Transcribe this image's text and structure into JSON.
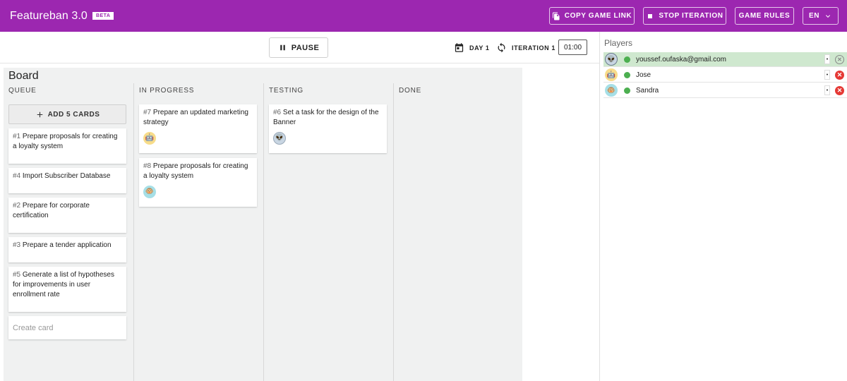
{
  "header": {
    "title": "Featureban 3.0",
    "badge": "BETA",
    "copy_link": "COPY GAME LINK",
    "stop_iteration": "STOP ITERATION",
    "game_rules": "GAME RULES",
    "language": "EN"
  },
  "toolbar": {
    "pause": "PAUSE",
    "day": "DAY 1",
    "iteration": "ITERATION 1",
    "timer": "01:00"
  },
  "board": {
    "title": "Board",
    "columns": {
      "queue": "QUEUE",
      "in_progress": "IN PROGRESS",
      "testing": "TESTING",
      "done": "DONE"
    },
    "add_cards": "ADD 5 CARDS",
    "queue_cards": [
      {
        "num": "#1",
        "text": "Prepare proposals for creating a loyalty system"
      },
      {
        "num": "#4",
        "text": "Import Subscriber Database"
      },
      {
        "num": "#2",
        "text": "Prepare for corporate certification"
      },
      {
        "num": "#3",
        "text": "Prepare a tender application"
      },
      {
        "num": "#5",
        "text": "Generate a list of hypotheses for improvements in user enrollment rate"
      }
    ],
    "create_card": "Create card",
    "progress_cards": [
      {
        "num": "#7",
        "text": "Prepare an updated marketing strategy",
        "avatar": "robot-avatar"
      },
      {
        "num": "#8",
        "text": "Prepare proposals for creating a loyalty system",
        "avatar": "monkey-avatar"
      }
    ],
    "testing_cards": [
      {
        "num": "#6",
        "text": "Set a task for the design of the Banner",
        "avatar": "alien-avatar"
      }
    ]
  },
  "players": {
    "title": "Players",
    "list": [
      {
        "name": "youssef.oufaska@gmail.com",
        "avatar": "alien-avatar",
        "status_color": "#4caf50",
        "mark": "•"
      },
      {
        "name": "Jose",
        "avatar": "robot-avatar",
        "status_color": "#4caf50",
        "mark": "•"
      },
      {
        "name": "Sandra",
        "avatar": "monkey-avatar",
        "status_color": "#4caf50",
        "mark": "•"
      }
    ]
  },
  "colors": {
    "header_bg": "#9c27b0",
    "online": "#4caf50",
    "remove": "#e53935",
    "active_player_bg": "#cfe8cf"
  }
}
